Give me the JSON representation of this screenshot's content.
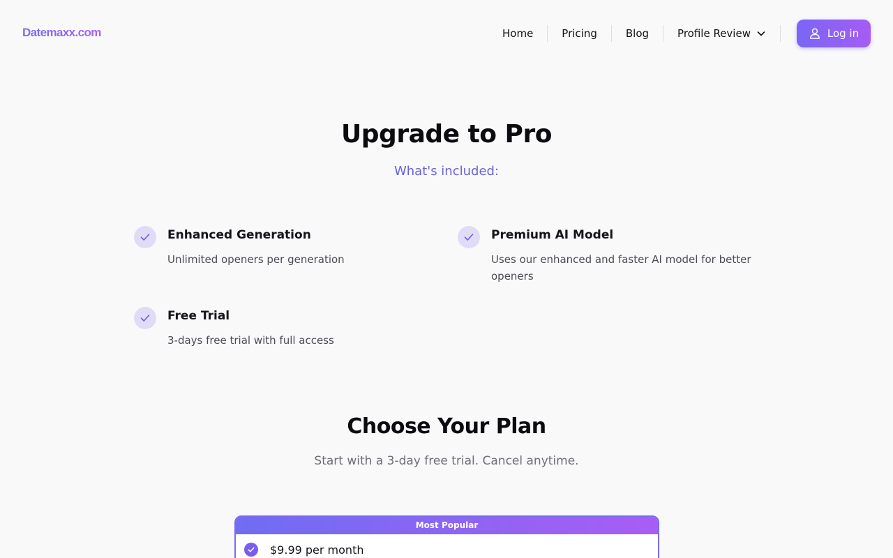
{
  "header": {
    "logo": "Datemaxx.com",
    "nav": [
      {
        "label": "Home"
      },
      {
        "label": "Pricing"
      },
      {
        "label": "Blog"
      },
      {
        "label": "Profile Review"
      }
    ],
    "login_label": "Log in"
  },
  "hero": {
    "title": "Upgrade to Pro",
    "subtitle": "What's included:"
  },
  "features": [
    {
      "title": "Enhanced Generation",
      "desc": "Unlimited openers per generation",
      "icon": "check-icon"
    },
    {
      "title": "Premium AI Model",
      "desc": "Uses our enhanced and faster AI model for better openers",
      "icon": "check-icon"
    },
    {
      "title": "Free Trial",
      "desc": "3-days free trial with full access",
      "icon": "check-icon"
    }
  ],
  "plans": {
    "title": "Choose Your Plan",
    "subtitle": "Start with a 3-day free trial. Cancel anytime.",
    "badge": "Most Popular",
    "selected_price": "$9.99 per month"
  },
  "colors": {
    "accent": "#7a66f5",
    "accent_end": "#a55cf3",
    "check_bg": "#e0dcf7",
    "subtitle": "#6a63d8"
  }
}
